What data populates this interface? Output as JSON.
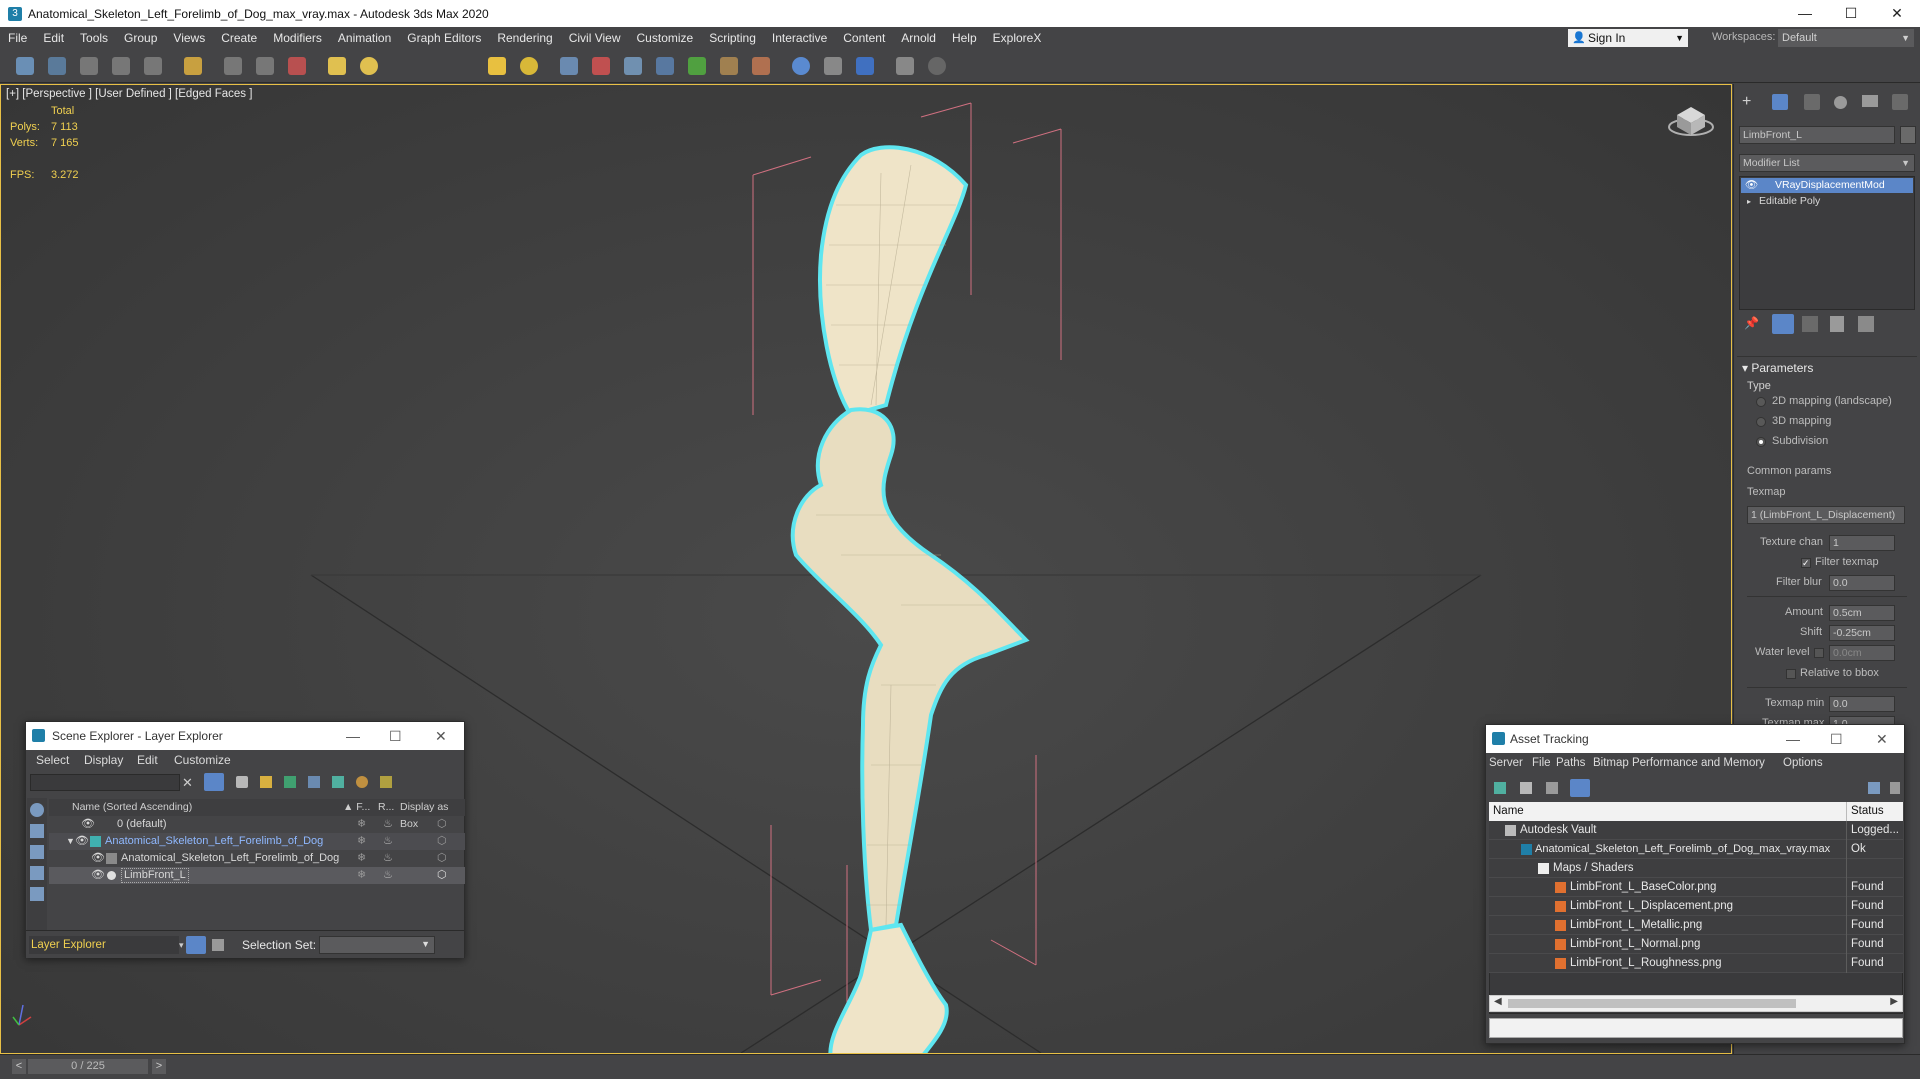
{
  "window": {
    "title": "Anatomical_Skeleton_Left_Forelimb_of_Dog_max_vray.max - Autodesk 3ds Max 2020",
    "minimize": "—",
    "maximize": "☐",
    "close": "✕"
  },
  "menu": [
    "File",
    "Edit",
    "Tools",
    "Group",
    "Views",
    "Create",
    "Modifiers",
    "Animation",
    "Graph Editors",
    "Rendering",
    "Civil View",
    "Customize",
    "Scripting",
    "Interactive",
    "Content",
    "Arnold",
    "Help",
    "ExploreX"
  ],
  "account": {
    "sign_in": "Sign In",
    "workspaces_label": "Workspaces:",
    "workspace_value": "Default"
  },
  "viewport": {
    "label": "[+] [Perspective ] [User Defined ] [Edged Faces ]",
    "stats": {
      "total_label": "Total",
      "polys_label": "Polys:",
      "polys_value": "7 113",
      "verts_label": "Verts:",
      "verts_value": "7 165",
      "fps_label": "FPS:",
      "fps_value": "3.272"
    }
  },
  "command_panel": {
    "object_name": "LimbFront_L",
    "modifier_list_label": "Modifier List",
    "stack": [
      {
        "label": "VRayDisplacementMod",
        "selected": true
      },
      {
        "label": "Editable Poly",
        "selected": false
      }
    ],
    "parameters_title": "Parameters",
    "type_label": "Type",
    "type_options": [
      {
        "label": "2D mapping (landscape)",
        "selected": false
      },
      {
        "label": "3D mapping",
        "selected": false
      },
      {
        "label": "Subdivision",
        "selected": true
      }
    ],
    "common_params_label": "Common params",
    "texmap_label": "Texmap",
    "texmap_value": "1 (LimbFront_L_Displacement)",
    "texture_chan_label": "Texture chan",
    "texture_chan_value": "1",
    "filter_texmap_label": "Filter texmap",
    "filter_blur_label": "Filter blur",
    "filter_blur_value": "0.0",
    "amount_label": "Amount",
    "amount_value": "0.5cm",
    "shift_label": "Shift",
    "shift_value": "-0.25cm",
    "water_level_label": "Water level",
    "water_level_value": "0.0cm",
    "relative_bbox_label": "Relative to bbox",
    "texmap_min_label": "Texmap min",
    "texmap_min_value": "0.0",
    "texmap_max_label": "Texmap max",
    "texmap_max_value": "1.0"
  },
  "scene_explorer": {
    "title": "Scene Explorer - Layer Explorer",
    "menu": [
      "Select",
      "Display",
      "Edit",
      "Customize"
    ],
    "columns": {
      "name": "Name (Sorted Ascending)",
      "f": "▲ F...",
      "r": "R...",
      "box": "Display as Box"
    },
    "rows": [
      {
        "label": "0 (default)",
        "indent": 1,
        "selected": false
      },
      {
        "label": "Anatomical_Skeleton_Left_Forelimb_of_Dog",
        "indent": 0,
        "selected": true
      },
      {
        "label": "Anatomical_Skeleton_Left_Forelimb_of_Dog",
        "indent": 2,
        "selected": false
      },
      {
        "label": "LimbFront_L",
        "indent": 2,
        "selected": true
      }
    ],
    "footer_label": "Layer Explorer",
    "selection_set_label": "Selection Set:"
  },
  "asset_tracking": {
    "title": "Asset Tracking",
    "menu": [
      "Server",
      "File",
      "Paths",
      "Bitmap Performance and Memory",
      "Options"
    ],
    "columns": {
      "name": "Name",
      "status": "Status"
    },
    "rows": [
      {
        "name": "Autodesk Vault",
        "status": "Logged...",
        "indent": 0
      },
      {
        "name": "Anatomical_Skeleton_Left_Forelimb_of_Dog_max_vray.max",
        "status": "Ok",
        "indent": 1
      },
      {
        "name": "Maps / Shaders",
        "status": "",
        "indent": 2
      },
      {
        "name": "LimbFront_L_BaseColor.png",
        "status": "Found",
        "indent": 3
      },
      {
        "name": "LimbFront_L_Displacement.png",
        "status": "Found",
        "indent": 3
      },
      {
        "name": "LimbFront_L_Metallic.png",
        "status": "Found",
        "indent": 3
      },
      {
        "name": "LimbFront_L_Normal.png",
        "status": "Found",
        "indent": 3
      },
      {
        "name": "LimbFront_L_Roughness.png",
        "status": "Found",
        "indent": 3
      }
    ]
  },
  "timeline": {
    "frame": "0 / 225",
    "prev": "<",
    "next": ">"
  },
  "colors": {
    "selection_blue": "#5b86c8",
    "viewport_border": "#e8c046",
    "model_outline": "#5fe6f0",
    "bone": "#efe4c8",
    "stat_yellow": "#f0d050"
  }
}
